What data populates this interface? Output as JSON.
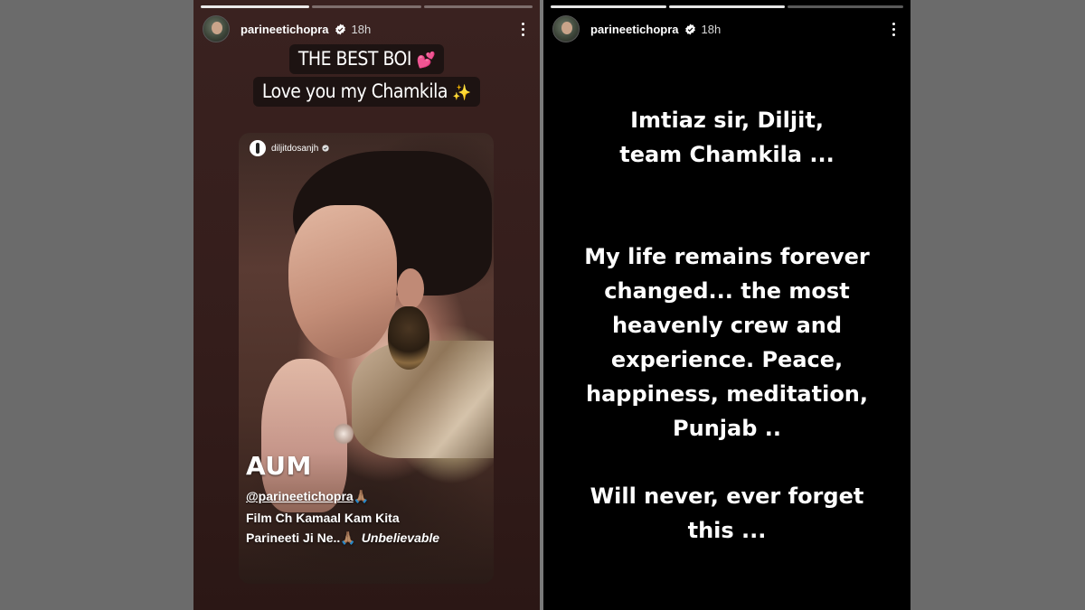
{
  "left_story": {
    "username": "parineetichopra",
    "time": "18h",
    "caption_line1": "THE BEST BOI",
    "caption_line1_emoji": "💕",
    "caption_line2": "Love you my Chamkila",
    "caption_line2_emoji": "✨",
    "shared_post": {
      "username": "diljitdosanjh",
      "title": "AUM",
      "mention": "@parineetichopra",
      "mention_emoji": "🙏🏽",
      "line1": "Film Ch Kamaal Kam Kita",
      "line2": "Parineeti Ji Ne..",
      "line2_emoji": "🙏🏽",
      "line2_italic": "Unbelievable"
    }
  },
  "right_story": {
    "username": "parineetichopra",
    "time": "18h",
    "text_block1": [
      "Imtiaz sir, Diljit,",
      "team Chamkila ..."
    ],
    "text_block2": [
      "My life remains forever",
      "changed... the most",
      "heavenly crew and",
      "experience. Peace,",
      "happiness, meditation,",
      "Punjab .."
    ],
    "text_block3": [
      "Will never, ever forget",
      "this ..."
    ]
  },
  "colors": {
    "page_bg": "#6b6b6b",
    "left_bg": "#3a2220",
    "right_bg": "#000000",
    "verified_blue": "#ffffff"
  },
  "icons": {
    "verified": "verified-badge-icon",
    "more": "more-options-icon"
  }
}
